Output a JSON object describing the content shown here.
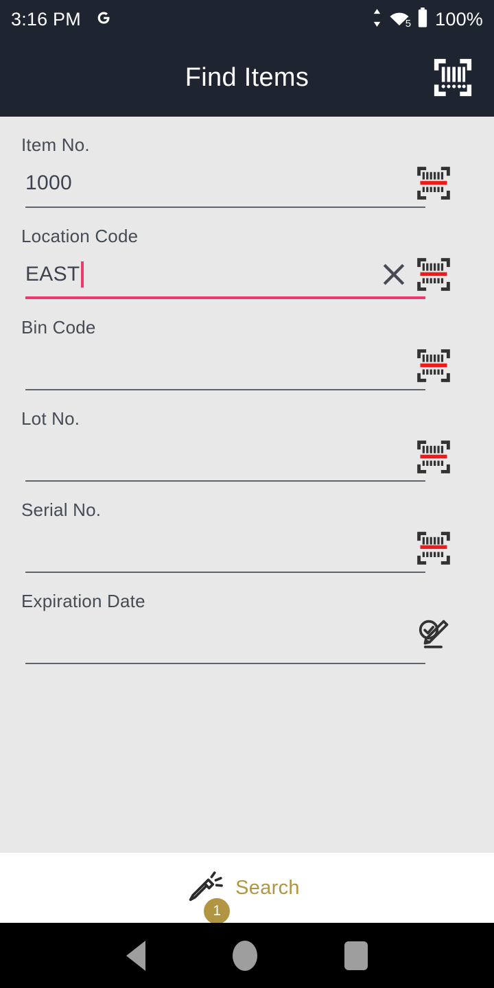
{
  "status_bar": {
    "time": "3:16 PM",
    "google_icon": "google-g-icon",
    "data_arrows_icon": "data-transfer-arrows-icon",
    "wifi_icon": "wifi-icon",
    "wifi_label": "5",
    "battery_icon": "battery-full-icon",
    "battery_percent": "100%"
  },
  "app_bar": {
    "title": "Find Items",
    "scan_icon": "barcode-scan-icon"
  },
  "form": {
    "fields": [
      {
        "label": "Item No.",
        "value": "1000",
        "focused": false,
        "has_clear": false,
        "action_icon": "barcode-scan-icon"
      },
      {
        "label": "Location Code",
        "value": "EAST",
        "focused": true,
        "has_clear": true,
        "action_icon": "barcode-scan-icon"
      },
      {
        "label": "Bin Code",
        "value": "",
        "focused": false,
        "has_clear": false,
        "action_icon": "barcode-scan-icon"
      },
      {
        "label": "Lot No.",
        "value": "",
        "focused": false,
        "has_clear": false,
        "action_icon": "barcode-scan-icon"
      },
      {
        "label": "Serial No.",
        "value": "",
        "focused": false,
        "has_clear": false,
        "action_icon": "barcode-scan-icon"
      },
      {
        "label": "Expiration Date",
        "value": "",
        "focused": false,
        "has_clear": false,
        "action_icon": "pencil-check-edit-icon"
      }
    ]
  },
  "bottom_bar": {
    "search_label": "Search",
    "search_icon": "flashlight-icon",
    "badge_count": "1"
  },
  "navigation_bar": {
    "back_icon": "nav-back-icon",
    "home_icon": "nav-home-icon",
    "recents_icon": "nav-recents-icon"
  },
  "colors": {
    "appbar_background": "#1e2430",
    "page_background": "#e8e8e8",
    "accent_focus": "#ea3a6e",
    "accent_gold": "#b29543",
    "scanline_red": "#ef1b1b",
    "label_text": "#454c55"
  }
}
